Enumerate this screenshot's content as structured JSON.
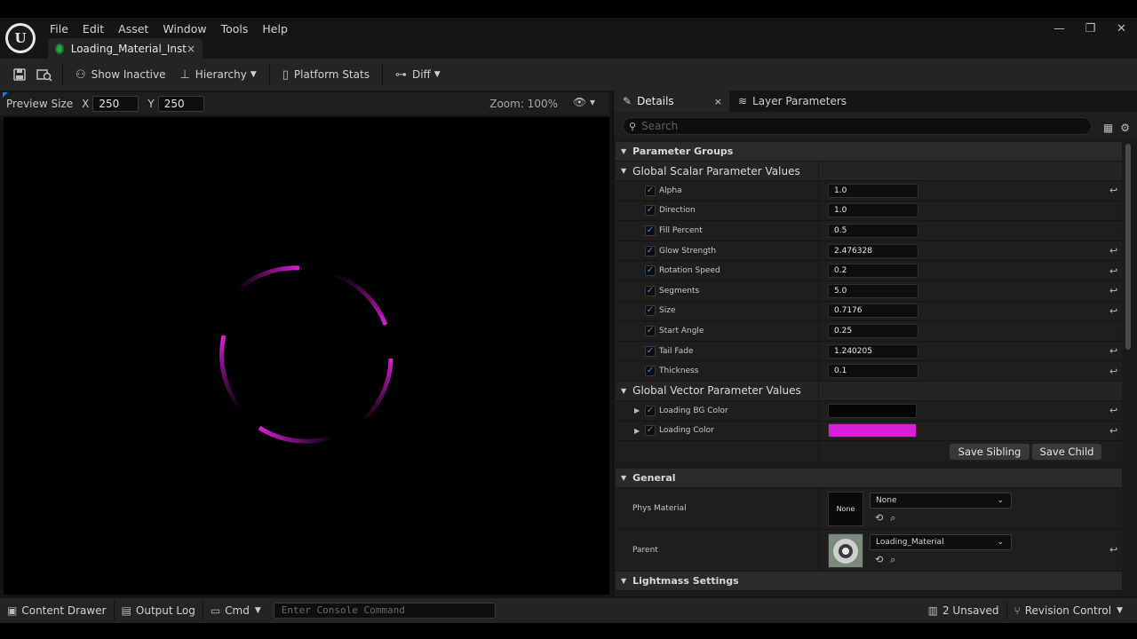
{
  "menu": [
    "File",
    "Edit",
    "Asset",
    "Window",
    "Tools",
    "Help"
  ],
  "document_tab": {
    "label": "Loading_Material_Inst",
    "close": "×"
  },
  "window_controls": {
    "minimize": "—",
    "restore": "❐",
    "close": "✕"
  },
  "toolbar": {
    "show_inactive": "Show Inactive",
    "hierarchy": "Hierarchy",
    "platform_stats": "Platform Stats",
    "diff": "Diff"
  },
  "viewport": {
    "preview_size_label": "Preview Size",
    "x_label": "X",
    "x_value": "250",
    "y_label": "Y",
    "y_value": "250",
    "zoom": "Zoom: 100%",
    "ring_color": "#d81ed8"
  },
  "details": {
    "tab_details": "Details",
    "tab_close": "×",
    "tab_layer_params": "Layer Parameters",
    "search_placeholder": "Search",
    "category_parameter_groups": "Parameter Groups",
    "scalar_group": {
      "title": "Global Scalar Parameter Values",
      "rows": [
        {
          "name": "Alpha",
          "value": "1.0",
          "reset": true
        },
        {
          "name": "Direction",
          "value": "1.0",
          "reset": false
        },
        {
          "name": "Fill Percent",
          "value": "0.5",
          "reset": false
        },
        {
          "name": "Glow Strength",
          "value": "2.476328",
          "reset": true
        },
        {
          "name": "Rotation Speed",
          "value": "0.2",
          "reset": true
        },
        {
          "name": "Segments",
          "value": "5.0",
          "reset": true
        },
        {
          "name": "Size",
          "value": "0.7176",
          "reset": true
        },
        {
          "name": "Start Angle",
          "value": "0.25",
          "reset": false
        },
        {
          "name": "Tail Fade",
          "value": "1.240205",
          "reset": true
        },
        {
          "name": "Thickness",
          "value": "0.1",
          "reset": true
        }
      ]
    },
    "vector_group": {
      "title": "Global Vector Parameter Values",
      "rows": [
        {
          "name": "Loading BG Color",
          "color": "#050505"
        },
        {
          "name": "Loading Color",
          "color": "#d81ed8"
        }
      ]
    },
    "save_sibling": "Save Sibling",
    "save_child": "Save Child",
    "category_general": "General",
    "phys_material": {
      "label": "Phys Material",
      "thumb": "None",
      "value": "None"
    },
    "parent": {
      "label": "Parent",
      "value": "Loading_Material"
    },
    "category_lightmass": "Lightmass Settings"
  },
  "bottombar": {
    "content_drawer": "Content Drawer",
    "output_log": "Output Log",
    "cmd": "Cmd",
    "console_placeholder": "Enter Console Command",
    "unsaved": "2 Unsaved",
    "revision_control": "Revision Control"
  }
}
